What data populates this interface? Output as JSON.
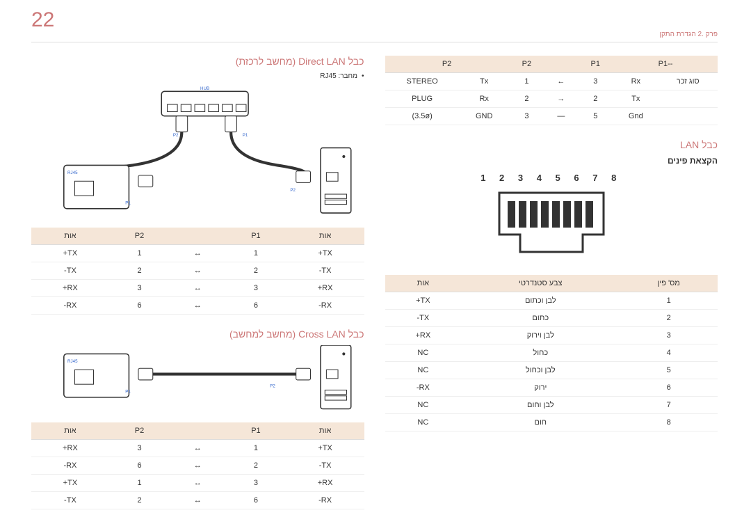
{
  "page_number": "22",
  "header": "פרק .2 הגדרת התקן",
  "right_col": {
    "stereo_table": {
      "headers": [
        "P2",
        "P2",
        "",
        "P1",
        "P1--"
      ],
      "rows": [
        [
          "STEREO",
          "Tx",
          "1",
          "←",
          "3",
          "Rx",
          "סוג זכר"
        ],
        [
          "PLUG",
          "Rx",
          "2",
          "→",
          "2",
          "Tx",
          ""
        ],
        [
          "(3.5ø)",
          "GND",
          "3",
          "—",
          "5",
          "Gnd",
          ""
        ]
      ]
    },
    "lan_title": "כבל LAN",
    "pin_sub": "הקצאת פינים",
    "pin_numbers": "1 2 3 4 5 6 7 8",
    "pin_table": {
      "headers": [
        "אות",
        "צבע סטנדרטי",
        "מס' פין"
      ],
      "rows": [
        [
          "TX+",
          "לבן וכתום",
          "1"
        ],
        [
          "TX-",
          "כתום",
          "2"
        ],
        [
          "RX+",
          "לבן וירוק",
          "3"
        ],
        [
          "NC",
          "כחול",
          "4"
        ],
        [
          "NC",
          "לבן וכחול",
          "5"
        ],
        [
          "RX-",
          "ירוק",
          "6"
        ],
        [
          "NC",
          "לבן וחום",
          "7"
        ],
        [
          "NC",
          "חום",
          "8"
        ]
      ]
    }
  },
  "left_col": {
    "direct_title": "כבל Direct LAN (מחשב לרכזת)",
    "connector_label": "מחבר: RJ45",
    "direct_table": {
      "headers": [
        "אות",
        "P2",
        "",
        "P1",
        "אות"
      ],
      "rows": [
        [
          "TX+",
          "1",
          "↔",
          "1",
          "TX+"
        ],
        [
          "TX-",
          "2",
          "↔",
          "2",
          "TX-"
        ],
        [
          "RX+",
          "3",
          "↔",
          "3",
          "RX+"
        ],
        [
          "RX-",
          "6",
          "↔",
          "6",
          "RX-"
        ]
      ]
    },
    "cross_title": "כבל Cross LAN (מחשב למחשב)",
    "cross_table": {
      "headers": [
        "אות",
        "P2",
        "",
        "P1",
        "אות"
      ],
      "rows": [
        [
          "RX+",
          "3",
          "↔",
          "1",
          "TX+"
        ],
        [
          "RX-",
          "6",
          "↔",
          "2",
          "TX-"
        ],
        [
          "TX+",
          "1",
          "↔",
          "3",
          "RX+"
        ],
        [
          "TX-",
          "2",
          "↔",
          "6",
          "RX-"
        ]
      ]
    }
  }
}
